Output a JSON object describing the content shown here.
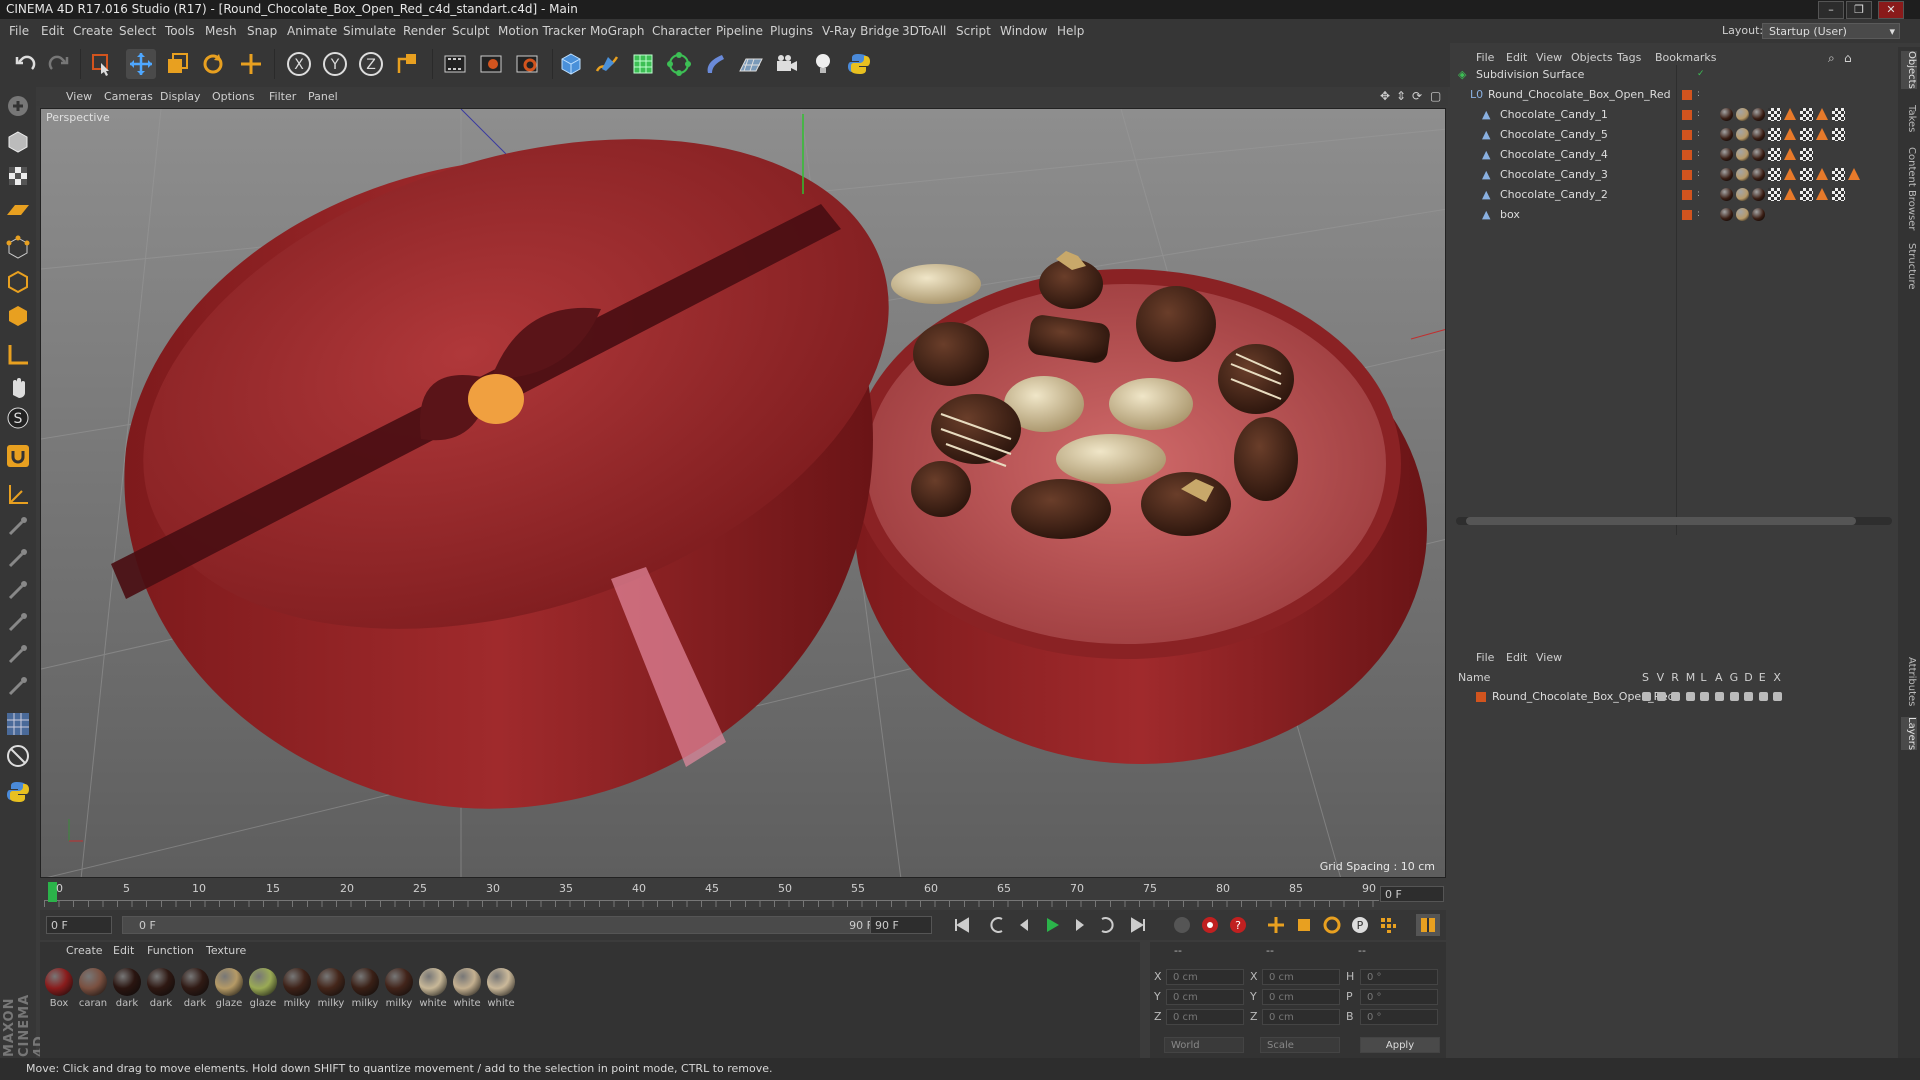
{
  "window": {
    "title": "CINEMA 4D R17.016 Studio (R17) - [Round_Chocolate_Box_Open_Red_c4d_standart.c4d] - Main",
    "controls": [
      "–",
      "❐",
      "✕"
    ]
  },
  "menubar": {
    "items": [
      "File",
      "Edit",
      "Create",
      "Select",
      "Tools",
      "Mesh",
      "Snap",
      "Animate",
      "Simulate",
      "Render",
      "Sculpt",
      "Motion Tracker",
      "MoGraph",
      "Character",
      "Pipeline",
      "Plugins",
      "V-Ray Bridge",
      "3DToAll",
      "Script",
      "Window",
      "Help"
    ],
    "layout_label": "Layout:",
    "layout_value": "Startup (User)"
  },
  "toolbar": {
    "icons": [
      "undo-icon",
      "redo-icon",
      "live-selection-icon",
      "move-icon",
      "scale-icon",
      "rotate-icon",
      "recent-tool-icon",
      "x-axis-icon",
      "y-axis-icon",
      "z-axis-icon",
      "coordinate-system-icon",
      "render-view-icon",
      "render-picture-viewer-icon",
      "render-settings-icon",
      "cube-icon",
      "pen-spline-icon",
      "subdivision-icon",
      "array-icon",
      "deformer-icon",
      "floor-icon",
      "camera-icon",
      "light-icon",
      "python-icon"
    ]
  },
  "viewport": {
    "menu": [
      "View",
      "Cameras",
      "Display",
      "Options",
      "Filter",
      "Panel"
    ],
    "label": "Perspective",
    "grid_spacing": "Grid Spacing : 10 cm"
  },
  "timeline": {
    "ticks": [
      "0",
      "5",
      "10",
      "15",
      "20",
      "25",
      "30",
      "35",
      "40",
      "45",
      "50",
      "55",
      "60",
      "65",
      "70",
      "75",
      "80",
      "85",
      "90"
    ],
    "end_frame": "0 F"
  },
  "transport": {
    "current_frame": "0 F",
    "range_start": "0 F",
    "range_end": "90 F",
    "max_frame": "90 F"
  },
  "materials": {
    "menu": [
      "Create",
      "Edit",
      "Function",
      "Texture"
    ],
    "items": [
      {
        "label": "Box",
        "color": "#8a1c1c"
      },
      {
        "label": "caran",
        "color": "#7a5040"
      },
      {
        "label": "dark",
        "color": "#2a1510"
      },
      {
        "label": "dark",
        "color": "#2e1812"
      },
      {
        "label": "dark",
        "color": "#301a14"
      },
      {
        "label": "glaze",
        "color": "#b59a66"
      },
      {
        "label": "glaze",
        "color": "#9aaa55"
      },
      {
        "label": "milky",
        "color": "#3e2218"
      },
      {
        "label": "milky",
        "color": "#44261a"
      },
      {
        "label": "milky",
        "color": "#3a2016"
      },
      {
        "label": "milky",
        "color": "#42241a"
      },
      {
        "label": "white",
        "color": "#c8b898"
      },
      {
        "label": "white",
        "color": "#c4b090"
      },
      {
        "label": "white",
        "color": "#cbb99a"
      }
    ]
  },
  "coordinates": {
    "headers": [
      "--",
      "--",
      "--"
    ],
    "rows": [
      {
        "axis": "X",
        "pos": "0 cm",
        "size_axis": "X",
        "size": "0 cm",
        "rot_axis": "H",
        "rot": "0 °"
      },
      {
        "axis": "Y",
        "pos": "0 cm",
        "size_axis": "Y",
        "size": "0 cm",
        "rot_axis": "P",
        "rot": "0 °"
      },
      {
        "axis": "Z",
        "pos": "0 cm",
        "size_axis": "Z",
        "size": "0 cm",
        "rot_axis": "B",
        "rot": "0 °"
      }
    ],
    "mode1": "World",
    "mode2": "Scale",
    "apply": "Apply"
  },
  "status": "Move: Click and drag to move elements. Hold down SHIFT to quantize movement / add to the selection in point mode, CTRL to remove.",
  "object_manager": {
    "menu": [
      "File",
      "Edit",
      "View",
      "Objects",
      "Tags",
      "Bookmarks"
    ],
    "objects": [
      {
        "name": "Subdivision Surface",
        "indent": 0,
        "tags": 0
      },
      {
        "name": "Round_Chocolate_Box_Open_Red",
        "indent": 1,
        "tags": 0
      },
      {
        "name": "Chocolate_Candy_1",
        "indent": 2,
        "tags": 8
      },
      {
        "name": "Chocolate_Candy_5",
        "indent": 2,
        "tags": 8
      },
      {
        "name": "Chocolate_Candy_4",
        "indent": 2,
        "tags": 6
      },
      {
        "name": "Chocolate_Candy_3",
        "indent": 2,
        "tags": 9
      },
      {
        "name": "Chocolate_Candy_2",
        "indent": 2,
        "tags": 8
      },
      {
        "name": "box",
        "indent": 2,
        "tags": 3
      }
    ]
  },
  "layer_manager": {
    "menu": [
      "File",
      "Edit",
      "View"
    ],
    "columns": [
      "Name",
      "S",
      "V",
      "R",
      "M",
      "L",
      "A",
      "G",
      "D",
      "E",
      "X"
    ],
    "layers": [
      {
        "name": "Round_Chocolate_Box_Open_Red",
        "color": "#d2541e"
      }
    ]
  },
  "side_tabs": [
    "Objects",
    "Takes",
    "Content Browser",
    "Structure",
    "Attributes",
    "Layers"
  ],
  "brand": "MAXON CINEMA 4D",
  "colors": {
    "accent": "#d2541e",
    "box_red": "#8e1e1e",
    "chocolate": "#3a1e14"
  }
}
